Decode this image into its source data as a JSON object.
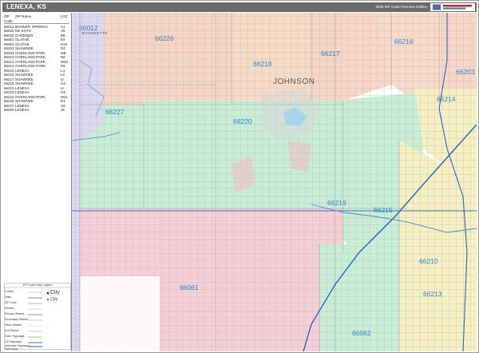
{
  "header": {
    "title": "LENEXA, KS",
    "subtitle": "2025 ZIP Code Premium Edition"
  },
  "index": {
    "head": {
      "zip": "ZIP Code",
      "name": "ZIP Name",
      "loc": "LOC"
    },
    "rows": [
      {
        "zip": "66012",
        "name": "BONNER SPRINGS",
        "loc": "C2"
      },
      {
        "zip": "66018",
        "name": "DE SOTO",
        "loc": "A5"
      },
      {
        "zip": "66030",
        "name": "GARDNER",
        "loc": "B8"
      },
      {
        "zip": "66061",
        "name": "OLATHE",
        "loc": "E9"
      },
      {
        "zip": "66062",
        "name": "OLATHE",
        "loc": "H10"
      },
      {
        "zip": "66203",
        "name": "SHAWNEE",
        "loc": "N2"
      },
      {
        "zip": "66204",
        "name": "OVERLAND PARK",
        "loc": "M8"
      },
      {
        "zip": "66210",
        "name": "OVERLAND PARK",
        "loc": "N6"
      },
      {
        "zip": "66213",
        "name": "OVERLAND PARK",
        "loc": "M10"
      },
      {
        "zip": "66214",
        "name": "OVERLAND PARK",
        "loc": "N5"
      },
      {
        "zip": "66215",
        "name": "LENEXA",
        "loc": "L4"
      },
      {
        "zip": "66216",
        "name": "SHAWNEE",
        "loc": "L2"
      },
      {
        "zip": "66217",
        "name": "SHAWNEE",
        "loc": "I2"
      },
      {
        "zip": "66218",
        "name": "SHAWNEE",
        "loc": "G2"
      },
      {
        "zip": "66219",
        "name": "LENEXA",
        "loc": "I4"
      },
      {
        "zip": "66220",
        "name": "LENEXA",
        "loc": "G5"
      },
      {
        "zip": "66223",
        "name": "OVERLAND PARK",
        "loc": "M11"
      },
      {
        "zip": "66226",
        "name": "SHAWNEE",
        "loc": "D1"
      },
      {
        "zip": "66227",
        "name": "LENEXA",
        "loc": "C6"
      },
      {
        "zip": "66250",
        "name": "LENEXA",
        "loc": "J6"
      }
    ]
  },
  "legend": {
    "title": "ZIP Codes Map Legend",
    "items": [
      {
        "label": "County"
      },
      {
        "label": "State"
      },
      {
        "label": "ZIP Code"
      },
      {
        "label": "Streets"
      },
      {
        "label": "Primary Streets"
      },
      {
        "label": "Secondary Streets"
      },
      {
        "label": "Minor Streets"
      },
      {
        "label": "Exit Ramps"
      },
      {
        "label": "State Highways"
      },
      {
        "label": "US Highways"
      },
      {
        "label": "Interstate Highways"
      },
      {
        "label": "Toll Roads"
      }
    ],
    "city_big": "City",
    "city_small": "City"
  },
  "map": {
    "county_johnson": "JOHNSON",
    "county_wyandotte": "WYANDOTTE",
    "zips": [
      "66012",
      "66226",
      "66218",
      "66217",
      "66216",
      "66203",
      "66227",
      "66220",
      "66214",
      "66219",
      "66215",
      "66210",
      "66061",
      "66062",
      "66213"
    ]
  },
  "colors": {
    "title_bg": "#6b6b6b",
    "peach": "#f8d6c6",
    "green": "#c8efd6",
    "pink": "#f6cfd4",
    "yellow": "#f6efbf",
    "lavender": "#ddd8ef",
    "zip_label": "#2f86d6",
    "highway": "#3d78c7"
  }
}
